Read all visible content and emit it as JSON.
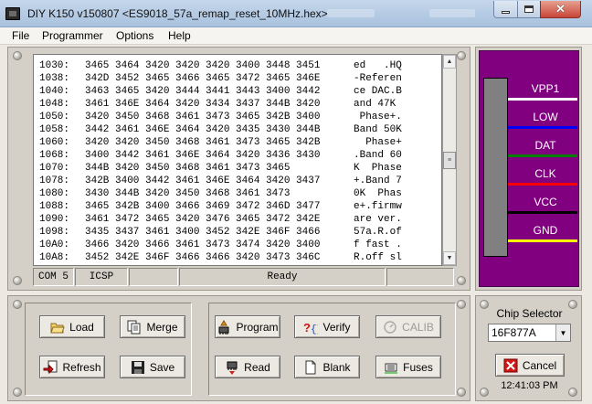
{
  "window": {
    "title": "DIY K150 v150807   <ES9018_57a_remap_reset_10MHz.hex>",
    "minimize_icon": "minimize-icon",
    "maximize_icon": "maximize-icon",
    "close_glyph": "✕"
  },
  "menu": {
    "items": [
      "File",
      "Programmer",
      "Options",
      "Help"
    ]
  },
  "hex_view": {
    "lines": [
      {
        "addr": "1030:",
        "hex": "3465 3464 3420 3420 3420 3400 3448 3451",
        "ascii": "ed   .HQ"
      },
      {
        "addr": "1038:",
        "hex": "342D 3452 3465 3466 3465 3472 3465 346E",
        "ascii": "-Referen"
      },
      {
        "addr": "1040:",
        "hex": "3463 3465 3420 3444 3441 3443 3400 3442",
        "ascii": "ce DAC.B"
      },
      {
        "addr": "1048:",
        "hex": "3461 346E 3464 3420 3434 3437 344B 3420",
        "ascii": "and 47K "
      },
      {
        "addr": "1050:",
        "hex": "3420 3450 3468 3461 3473 3465 342B 3400",
        "ascii": " Phase+."
      },
      {
        "addr": "1058:",
        "hex": "3442 3461 346E 3464 3420 3435 3430 344B",
        "ascii": "Band 50K"
      },
      {
        "addr": "1060:",
        "hex": "3420 3420 3450 3468 3461 3473 3465 342B",
        "ascii": "  Phase+"
      },
      {
        "addr": "1068:",
        "hex": "3400 3442 3461 346E 3464 3420 3436 3430",
        "ascii": ".Band 60"
      },
      {
        "addr": "1070:",
        "hex": "344B 3420 3450 3468 3461 3473 3465",
        "ascii": "K  Phase"
      },
      {
        "addr": "1078:",
        "hex": "342B 3400 3442 3461 346E 3464 3420 3437",
        "ascii": "+.Band 7"
      },
      {
        "addr": "1080:",
        "hex": "3430 344B 3420 3450 3468 3461 3473",
        "ascii": "0K  Phas"
      },
      {
        "addr": "1088:",
        "hex": "3465 342B 3400 3466 3469 3472 346D 3477",
        "ascii": "e+.firmw"
      },
      {
        "addr": "1090:",
        "hex": "3461 3472 3465 3420 3476 3465 3472 342E",
        "ascii": "are ver."
      },
      {
        "addr": "1098:",
        "hex": "3435 3437 3461 3400 3452 342E 346F 3466",
        "ascii": "57a.R.of"
      },
      {
        "addr": "10A0:",
        "hex": "3466 3420 3466 3461 3473 3474 3420 3400",
        "ascii": "f fast ."
      },
      {
        "addr": "10A8:",
        "hex": "3452 342E 346F 3466 3466 3420 3473 346C",
        "ascii": "R.off sl"
      }
    ]
  },
  "status": {
    "port": "COM 5",
    "mode": "ICSP",
    "message": "Ready"
  },
  "chip_pins": [
    {
      "label": "VPP1",
      "color": "#ffffff"
    },
    {
      "label": "LOW",
      "color": "#0000ff"
    },
    {
      "label": "DAT",
      "color": "#008000"
    },
    {
      "label": "CLK",
      "color": "#ff0000"
    },
    {
      "label": "VCC",
      "color": "#000000"
    },
    {
      "label": "GND",
      "color": "#ffff00"
    }
  ],
  "buttons": {
    "load": "Load",
    "merge": "Merge",
    "refresh": "Refresh",
    "save": "Save",
    "program": "Program",
    "verify": "Verify",
    "calib": "CALIB",
    "read": "Read",
    "blank": "Blank",
    "fuses": "Fuses",
    "cancel": "Cancel"
  },
  "chip_selector": {
    "label": "Chip Selector",
    "value": "16F877A"
  },
  "clock": "12:41:03 PM",
  "colors": {
    "chip_panel_bg": "#800080",
    "chip_body": "#808080"
  }
}
